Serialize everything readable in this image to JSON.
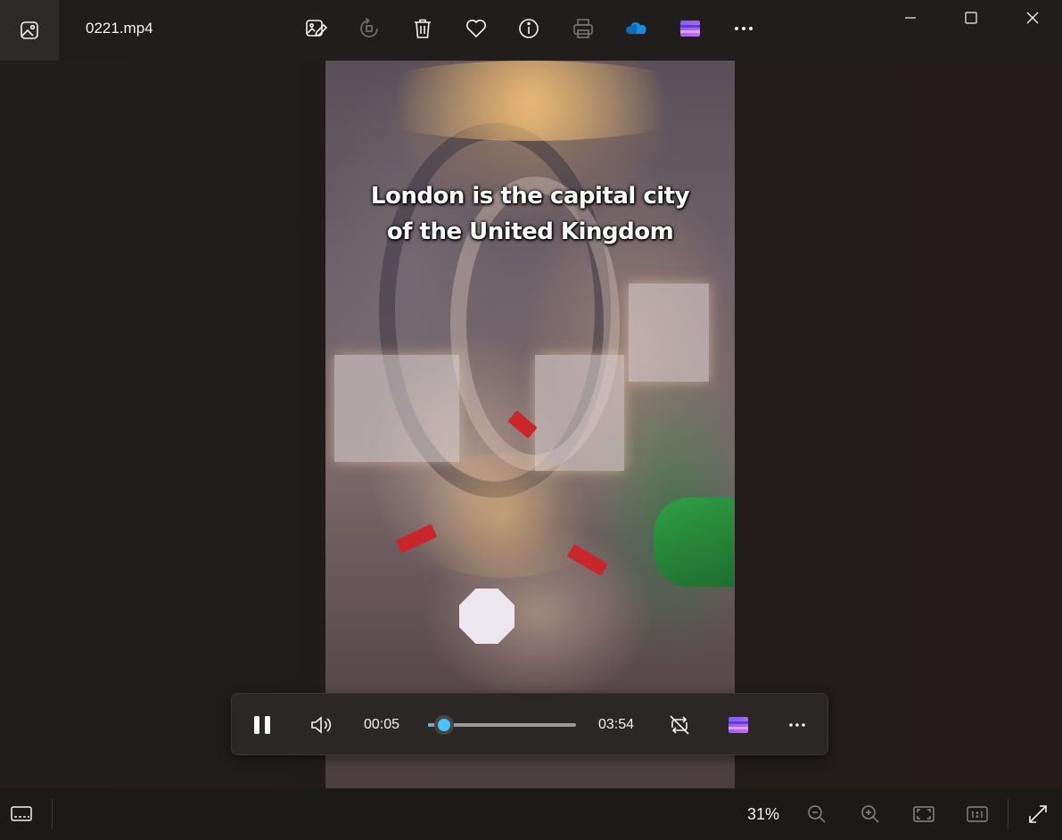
{
  "window": {
    "title": "0221.mp4",
    "controls": [
      "minimize-icon",
      "maximize-icon",
      "close-icon"
    ]
  },
  "toolbar": {
    "items": [
      "edit-image-icon",
      "rotate-icon",
      "delete-icon",
      "favorite-icon",
      "info-icon",
      "print-icon",
      "onedrive-icon",
      "clipchamp-icon",
      "more-icon"
    ]
  },
  "video": {
    "caption_line1": "London is the capital city",
    "caption_line2": "of the United Kingdom"
  },
  "player": {
    "current_time": "00:05",
    "total_time": "03:54",
    "progress": 0.021,
    "accent_color": "#4cc2ff"
  },
  "statusbar": {
    "zoom_level": "31%"
  },
  "colors": {
    "background": "#221d1d",
    "panel": "#2c2727",
    "accent": "#4cc2ff",
    "onedrive": "#1a8be0",
    "clipchamp": "#a06cf0"
  }
}
